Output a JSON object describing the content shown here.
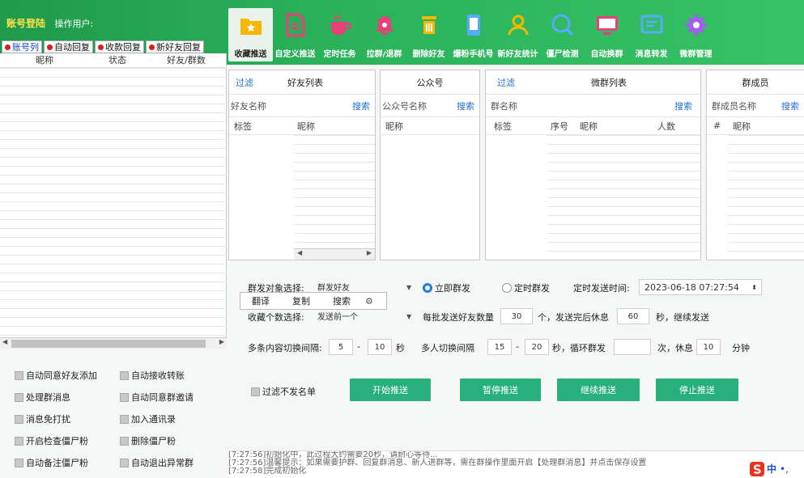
{
  "header": {
    "login_title": "账号登陆",
    "operator_label": "操作用户:"
  },
  "left_tabs": [
    {
      "label": "账号列"
    },
    {
      "label": "自动回复"
    },
    {
      "label": "收款回复"
    },
    {
      "label": "新好友回复"
    }
  ],
  "toolbar": [
    {
      "label": "收藏推送",
      "icon": "folder-star-icon",
      "color": "#f5b700"
    },
    {
      "label": "自定义推送",
      "icon": "document-icon",
      "color": "#e8407a"
    },
    {
      "label": "定时任务",
      "icon": "coffee-cup-icon",
      "color": "#e8407a"
    },
    {
      "label": "拉群/退群",
      "icon": "bell-icon",
      "color": "#e8407a"
    },
    {
      "label": "删除好友",
      "icon": "trash-icon",
      "color": "#f5b700"
    },
    {
      "label": "爆粉手机号",
      "icon": "phone-icon",
      "color": "#59a9ff"
    },
    {
      "label": "新好友统计",
      "icon": "user-icon",
      "color": "#f5b700"
    },
    {
      "label": "僵尸检测",
      "icon": "search-icon",
      "color": "#59a9ff"
    },
    {
      "label": "自动换群",
      "icon": "monitor-icon",
      "color": "#e8407a"
    },
    {
      "label": "消息转发",
      "icon": "message-icon",
      "color": "#59a9ff"
    },
    {
      "label": "微群管理",
      "icon": "gear-icon",
      "color": "#a45cf0"
    }
  ],
  "account_table": {
    "headers": [
      "昵称",
      "状态",
      "好友/群数"
    ]
  },
  "left_checks": [
    "自动同意好友添加",
    "自动接收转账",
    "处理群消息",
    "自动同意群邀请",
    "消息免打扰",
    "加入通讯录",
    "开启检查僵尸粉",
    "删除僵尸粉",
    "自动备注僵尸粉",
    "自动退出异常群"
  ],
  "friends_panel": {
    "filter": "过滤",
    "title": "好友列表",
    "search_placeholder": "好友名称",
    "search_btn": "搜索",
    "cols": [
      "标签",
      "昵称"
    ]
  },
  "official_panel": {
    "title": "公众号",
    "search_placeholder": "公众号名称",
    "search_btn": "搜索",
    "cols": [
      "昵称"
    ]
  },
  "groups_panel": {
    "filter": "过滤",
    "title": "微群列表",
    "search_placeholder": "群名称",
    "search_btn": "搜索",
    "cols": [
      "标签",
      "序号",
      "昵称",
      "人数"
    ]
  },
  "members_panel": {
    "title": "群成员",
    "search_placeholder": "群成员名称",
    "search_btn": "搜索",
    "cols": [
      "#",
      "昵称"
    ]
  },
  "settings": {
    "target_label": "群发对象选择:",
    "target_value": "群发好友",
    "send_now": "立即群发",
    "send_timed": "定时群发",
    "timed_label": "定时发送时间:",
    "timed_value": "2023-06-18 07:27:54",
    "popup": [
      "翻译",
      "复制",
      "搜索"
    ],
    "fav_count_label": "收藏个数选择:",
    "fav_count_value": "发送前一个",
    "batch_label": "每批发送好友数量",
    "batch_value": "30",
    "batch_unit": "个，发送完后休息",
    "rest_value": "60",
    "rest_unit": "秒，继续发送",
    "multi_interval_label": "多条内容切换间隔:",
    "multi_min": "5",
    "multi_max": "10",
    "sec": "秒",
    "person_interval_label": "多人切换间隔",
    "person_min": "15",
    "person_max": "20",
    "loop_label": "秒，循环群发",
    "loop_value": "",
    "loop_unit": "次，休息",
    "rest2_value": "10",
    "minute": "分钟",
    "filter_unsent": "过滤不发名单",
    "dash": "-"
  },
  "buttons": {
    "start": "开始推送",
    "pause": "暂停推送",
    "resume": "继续推送",
    "stop": "停止推送"
  },
  "log": [
    "[7:27:56]初始化中，此过程大约需要20秒，请耐心等待...",
    "[7:27:56]温馨提示：如果需要护群、回复群消息、新人进群等，需在群操作里面开启【处理群消息】并点击保存设置",
    "[7:27:58]完成初始化"
  ],
  "ime": {
    "mode": "中"
  }
}
